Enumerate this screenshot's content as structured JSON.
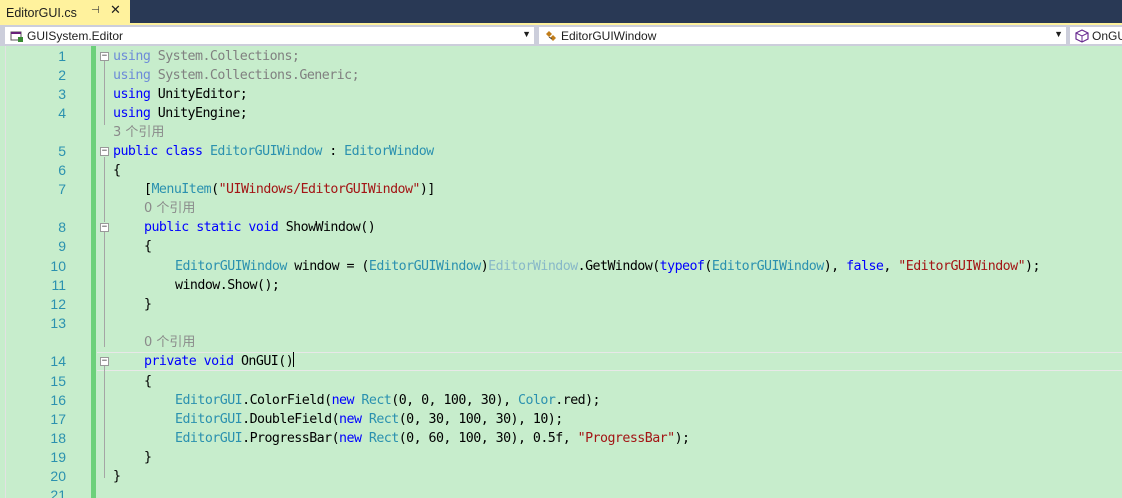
{
  "tab": {
    "title": "EditorGUI.cs",
    "pin_glyph": "⊣",
    "close_glyph": "✕"
  },
  "nav": {
    "project": "GUISystem.Editor",
    "type": "EditorGUIWindow",
    "member": "OnGUI"
  },
  "line_numbers": [
    "1",
    "2",
    "3",
    "4",
    "5",
    "6",
    "7",
    "8",
    "9",
    "10",
    "11",
    "12",
    "13",
    "14",
    "15",
    "16",
    "17",
    "18",
    "19",
    "20",
    "21"
  ],
  "code": {
    "l1": {
      "kw": "using",
      "rest": " System.Collections;"
    },
    "l2": {
      "kw": "using",
      "rest": " System.Collections.Generic;"
    },
    "l3": {
      "kw": "using",
      "rest": " UnityEditor;"
    },
    "l4": {
      "kw": "using",
      "rest": " UnityEngine;"
    },
    "lens1": "3 个引用",
    "l5": {
      "kw1": "public",
      "kw2": "class",
      "name": "EditorGUIWindow",
      "colon": " : ",
      "base": "EditorWindow"
    },
    "l6": "{",
    "l7": {
      "open": "[",
      "attr": "MenuItem",
      "paren": "(",
      "str": "\"UIWindows/EditorGUIWindow\"",
      "close": ")]"
    },
    "lens2": "0 个引用",
    "l8": {
      "kw1": "public",
      "kw2": "static",
      "kw3": "void",
      "name": "ShowWindow()"
    },
    "l9": "{",
    "l10": {
      "type1": "EditorGUIWindow",
      "var": " window = (",
      "type2": "EditorGUIWindow",
      "cast_close": ")",
      "type3": "EditorWindow",
      "call": ".GetWindow(",
      "kw": "typeof",
      "paren": "(",
      "type4": "EditorGUIWindow",
      "sep": "), ",
      "kw2": "false",
      "comma": ", ",
      "str": "\"EditorGUIWindow\"",
      "end": ");"
    },
    "l11": "window.Show();",
    "l12": "}",
    "lens3": "0 个引用",
    "l14": {
      "kw1": "private",
      "kw2": "void",
      "name": "OnGUI()"
    },
    "l15": "{",
    "l16": {
      "cls": "EditorGUI",
      "call": ".ColorField(",
      "kw": "new",
      "type": "Rect",
      "args": "(0, 0, 100, 30), ",
      "col": "Color",
      "end": ".red);"
    },
    "l17": {
      "cls": "EditorGUI",
      "call": ".DoubleField(",
      "kw": "new",
      "type": "Rect",
      "args": "(0, 30, 100, 30), 10);"
    },
    "l18": {
      "cls": "EditorGUI",
      "call": ".ProgressBar(",
      "kw": "new",
      "type": "Rect",
      "args": "(0, 60, 100, 30), 0.5f, ",
      "str": "\"ProgressBar\"",
      "end": ");"
    },
    "l19": "}",
    "l20": "}"
  },
  "colors": {
    "background": "#c7edcc",
    "keyword": "#0000ff",
    "type": "#2b91af",
    "string": "#a31515",
    "tab_active": "#fff29d"
  }
}
